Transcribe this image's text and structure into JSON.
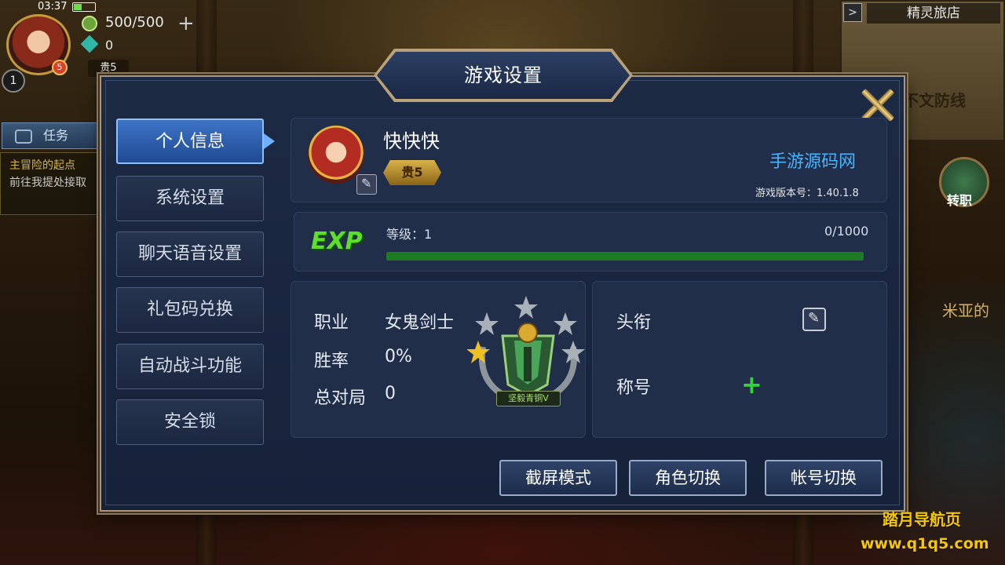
{
  "hud": {
    "time": "03:37",
    "energy": "500/500",
    "gems": "0",
    "level": "1",
    "avatar_badge": "5",
    "vip": "贵5"
  },
  "task": {
    "tab_label": "任务",
    "line1": "主冒险的起点",
    "line2": "前往我提处接取"
  },
  "map": {
    "title": "精灵旅店",
    "sign": "不文防线",
    "side_button": "转职",
    "side_text": "米亚的"
  },
  "dialog": {
    "title": "游戏设置",
    "menu": [
      {
        "label": "个人信息",
        "active": true
      },
      {
        "label": "系统设置",
        "active": false
      },
      {
        "label": "聊天语音设置",
        "active": false
      },
      {
        "label": "礼包码兑换",
        "active": false
      },
      {
        "label": "自动战斗功能",
        "active": false
      },
      {
        "label": "安全锁",
        "active": false
      }
    ],
    "profile": {
      "name": "快快快",
      "vip_badge": "贵5",
      "source": "手游源码网",
      "version": "游戏版本号：1.40.1.8"
    },
    "exp": {
      "logo": "EXP",
      "level_text": "等级：1",
      "value": "0/1000",
      "fill_fraction": 1.0
    },
    "stats": {
      "class_label": "职业",
      "class_value": "女鬼剑士",
      "winrate_label": "胜率",
      "winrate_value": "0%",
      "matches_label": "总对局",
      "matches_value": "0",
      "rank_label": "坚毅青铜V"
    },
    "honors": {
      "title_label": "头衔",
      "nickname_label": "称号"
    },
    "buttons": {
      "screenshot": "截屏模式",
      "switch_role": "角色切换",
      "switch_account": "帐号切换"
    }
  },
  "watermark": {
    "line1": "踏月导航页",
    "line2": "www.q1q5.com"
  }
}
